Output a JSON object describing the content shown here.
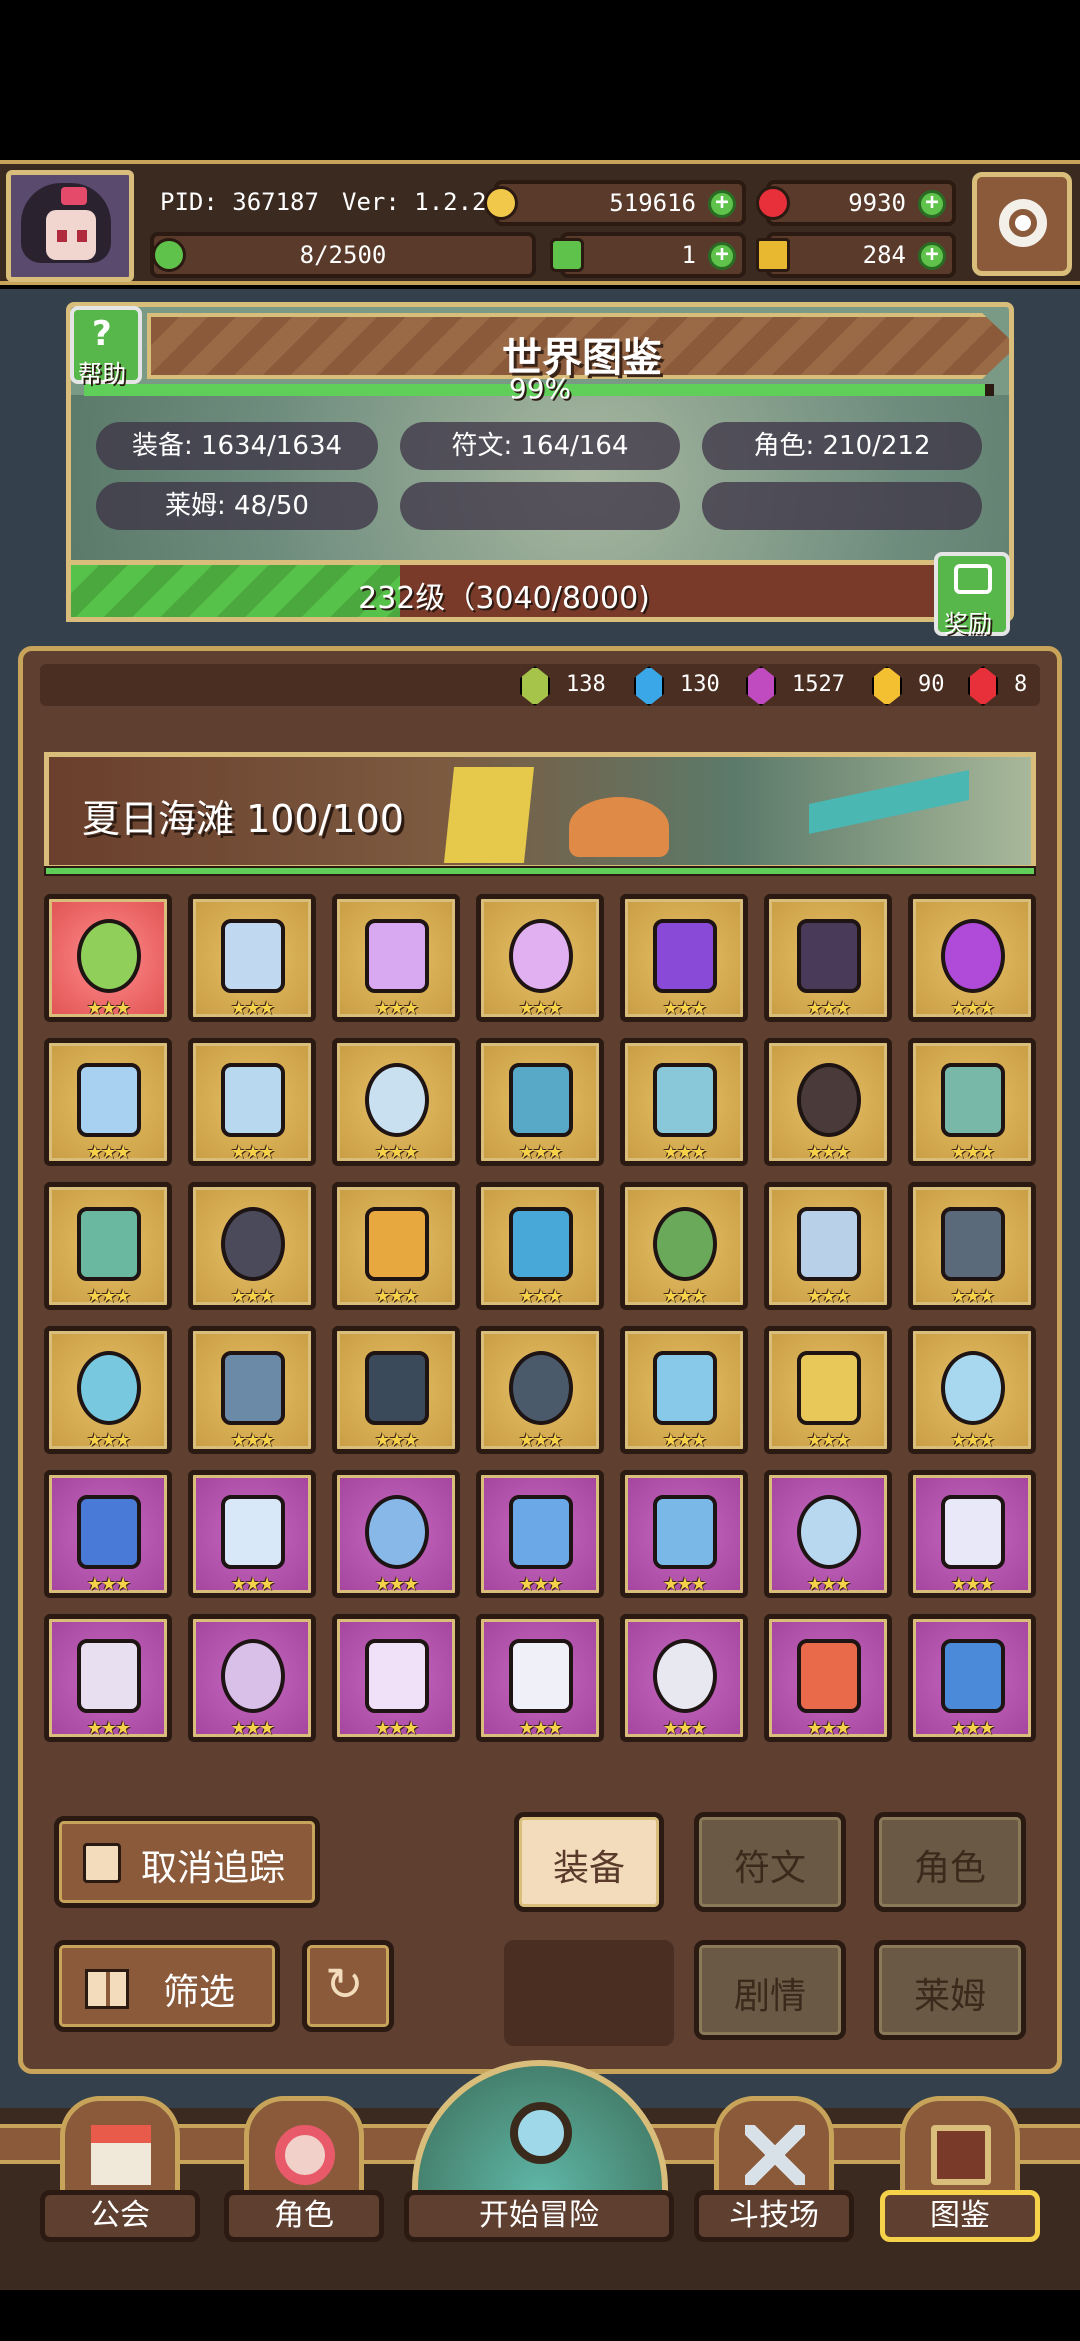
{
  "header": {
    "pid": "PID: 367187",
    "version": "Ver: 1.2.2.6",
    "gold": "519616",
    "ruby": "9930",
    "stamina": "8/2500",
    "clover": "1",
    "key": "284"
  },
  "codex": {
    "help_label": "帮助",
    "title": "世界图鉴",
    "percent": "99%",
    "percent_value": 0.99,
    "stats": {
      "equipment": "装备: 1634/1634",
      "rune": "符文: 164/164",
      "character": "角色: 210/212",
      "slime": "莱姆: 48/50"
    },
    "level_text": "232级（3040/8000)",
    "level_progress": 0.38,
    "reward_label": "奖励"
  },
  "gems": [
    {
      "color": "#a7c44a",
      "count": "138"
    },
    {
      "color": "#3aa8e8",
      "count": "130"
    },
    {
      "color": "#c04ac0",
      "count": "1527"
    },
    {
      "color": "#f2c030",
      "count": "90"
    },
    {
      "color": "#e8303a",
      "count": "8"
    }
  ],
  "banner": {
    "title": "夏日海滩 100/100"
  },
  "grid": {
    "stars": "★★★",
    "rows": [
      [
        {
          "bg": "red",
          "color": "#8fcf5a"
        },
        {
          "bg": "gold",
          "color": "#c0d8f0"
        },
        {
          "bg": "gold",
          "color": "#d8a8f0"
        },
        {
          "bg": "gold",
          "color": "#e0b0f0"
        },
        {
          "bg": "gold",
          "color": "#8a4ad8"
        },
        {
          "bg": "gold",
          "color": "#4a3a5a"
        },
        {
          "bg": "gold",
          "color": "#b04ad8"
        }
      ],
      [
        {
          "bg": "gold",
          "color": "#a8d0f0"
        },
        {
          "bg": "gold",
          "color": "#b8d8f0"
        },
        {
          "bg": "gold",
          "color": "#c8e0f0"
        },
        {
          "bg": "gold",
          "color": "#58a8c8"
        },
        {
          "bg": "gold",
          "color": "#88c8d8"
        },
        {
          "bg": "gold",
          "color": "#4a3a3a"
        },
        {
          "bg": "gold",
          "color": "#78b8a8"
        }
      ],
      [
        {
          "bg": "gold",
          "color": "#6ab8a0"
        },
        {
          "bg": "gold",
          "color": "#4a4a5a"
        },
        {
          "bg": "gold",
          "color": "#e8a840"
        },
        {
          "bg": "gold",
          "color": "#48a8d8"
        },
        {
          "bg": "gold",
          "color": "#6aa85a"
        },
        {
          "bg": "gold",
          "color": "#b8d0e8"
        },
        {
          "bg": "gold",
          "color": "#5a6a7a"
        }
      ],
      [
        {
          "bg": "gold",
          "color": "#78c8e0"
        },
        {
          "bg": "gold",
          "color": "#6a8aa8"
        },
        {
          "bg": "gold",
          "color": "#3a4a5a"
        },
        {
          "bg": "gold",
          "color": "#4a5a6a"
        },
        {
          "bg": "gold",
          "color": "#88c8e8"
        },
        {
          "bg": "gold",
          "color": "#e8c858"
        },
        {
          "bg": "gold",
          "color": "#a8d8f0"
        }
      ],
      [
        {
          "bg": "purple",
          "color": "#4a7ad8"
        },
        {
          "bg": "purple",
          "color": "#d8e8f8"
        },
        {
          "bg": "purple",
          "color": "#88b8e8"
        },
        {
          "bg": "purple",
          "color": "#6aa8e8"
        },
        {
          "bg": "purple",
          "color": "#7ab8e8"
        },
        {
          "bg": "purple",
          "color": "#b8d8f0"
        },
        {
          "bg": "purple",
          "color": "#e8e8f8"
        }
      ],
      [
        {
          "bg": "purple",
          "color": "#e8e0f0"
        },
        {
          "bg": "purple",
          "color": "#d8c0e8"
        },
        {
          "bg": "purple",
          "color": "#f0e0f8"
        },
        {
          "bg": "purple",
          "color": "#f0f0f8"
        },
        {
          "bg": "purple",
          "color": "#e8e8f0"
        },
        {
          "bg": "purple",
          "color": "#e86a4a"
        },
        {
          "bg": "purple",
          "color": "#4a8ad8"
        }
      ]
    ]
  },
  "controls": {
    "untrack": "取消追踪",
    "filter": "筛选",
    "tabs": [
      "装备",
      "符文",
      "角色",
      "剧情",
      "莱姆"
    ]
  },
  "nav": {
    "guild": "公会",
    "character": "角色",
    "adventure": "开始冒险",
    "arena": "斗技场",
    "codex": "图鉴"
  }
}
